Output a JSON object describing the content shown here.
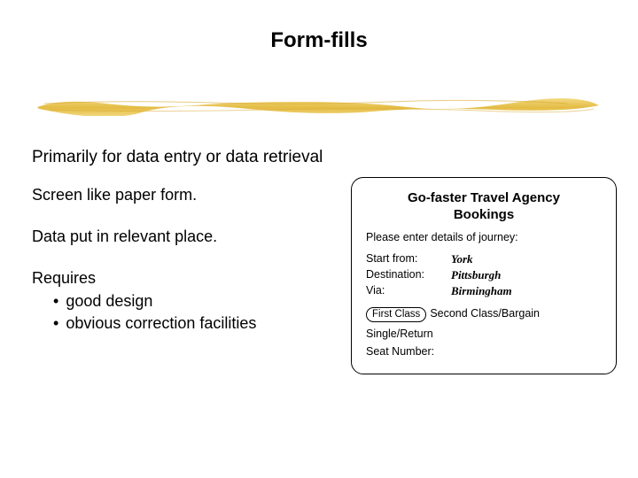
{
  "title": "Form-fills",
  "lines": {
    "l1": "Primarily for data entry or data retrieval",
    "l2": "Screen like paper form.",
    "l3": "Data put in relevant place."
  },
  "requires": {
    "heading": "Requires",
    "items": [
      "good design",
      "obvious correction facilities"
    ]
  },
  "form": {
    "title": "Go-faster Travel Agency",
    "subtitle": "Bookings",
    "instruction": "Please enter details of journey:",
    "fields": [
      {
        "label": "Start from:",
        "value": "York"
      },
      {
        "label": "Destination:",
        "value": "Pittsburgh"
      },
      {
        "label": "Via:",
        "value": "Birmingham"
      }
    ],
    "class_option_selected": "First Class",
    "class_option_rest": "Second Class/Bargain",
    "single_return": "Single/Return",
    "seat_number_label": "Seat Number:"
  },
  "colors": {
    "brush": "#e6c24a"
  }
}
